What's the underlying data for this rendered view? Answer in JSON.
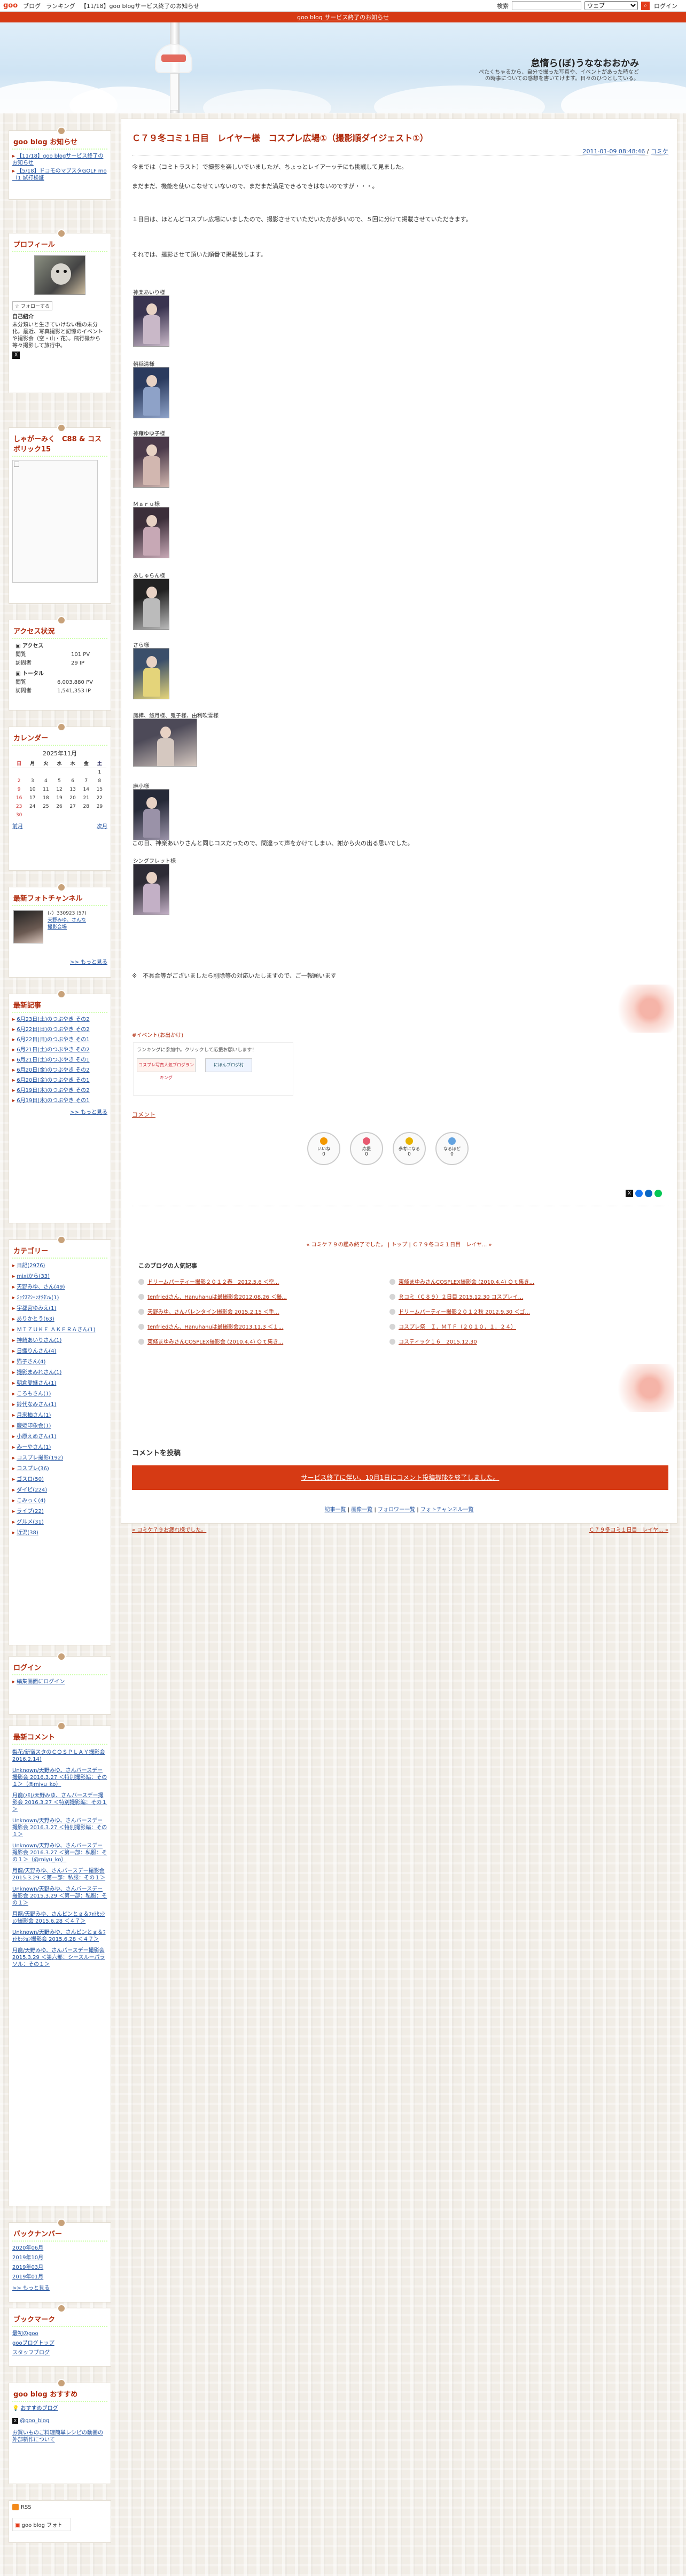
{
  "topbar": {
    "logo": "goo",
    "links": [
      "ブログ",
      "ランキング",
      "【11/18】goo blogサービス終了のお知らせ"
    ],
    "search_label": "検索",
    "search_select": "ウェブ",
    "login": "ログイン"
  },
  "notice": "goo blog サービス終了のお知らせ",
  "blog": {
    "title": "怠惰ら(ぼ)うななおおかみ",
    "description": "ぺたくちゃるから、自分で撮った写真や、イベントがあった時などの時事についての感想を書いてけます。日々のひつとしている。"
  },
  "sidebar": {
    "news": {
      "title": "goo blog お知らせ",
      "items": [
        "【11/18】goo blogサービス終了のお知らせ",
        "【5/18】ドコモのマブスタGOLF mo（1 試打検証"
      ]
    },
    "profile": {
      "title": "プロフィール",
      "follow": "フォローする",
      "intro_label": "自己紹介",
      "intro": "未分類いと生きていけない程の未分化。最近、写真撮影と記憶のイベントや撮影会（空・山・花）。飛行機から等々撮影して旅行中。"
    },
    "ad": {
      "title": "しゃがーみく　C88 & コスボリック15"
    },
    "access": {
      "title": "アクセス状況",
      "access_label": "アクセス",
      "today_view": "閲覧",
      "today_view_val": "101 PV",
      "today_visit": "訪問者",
      "today_visit_val": "29 IP",
      "total_label": "トータル",
      "total_view": "閲覧",
      "total_view_val": "6,003,880 PV",
      "total_visit": "訪問者",
      "total_visit_val": "1,541,353 IP"
    },
    "calendar": {
      "title": "カレンダー",
      "month": "2025年11月",
      "days": [
        "日",
        "月",
        "火",
        "水",
        "木",
        "金",
        "土"
      ],
      "weeks": [
        [
          "",
          "",
          "",
          "",
          "",
          "",
          "1"
        ],
        [
          "2",
          "3",
          "4",
          "5",
          "6",
          "7",
          "8"
        ],
        [
          "9",
          "10",
          "11",
          "12",
          "13",
          "14",
          "15"
        ],
        [
          "16",
          "17",
          "18",
          "19",
          "20",
          "21",
          "22"
        ],
        [
          "23",
          "24",
          "25",
          "26",
          "27",
          "28",
          "29"
        ],
        [
          "30",
          "",
          "",
          "",
          "",
          "",
          ""
        ]
      ],
      "prev": "前月",
      "next": "次月"
    },
    "photo": {
      "title": "最新フォトチャンネル",
      "count": "(ﾉ）330923 (57)",
      "name": "天野みゆ、さんな",
      "sub": "撮影会場",
      "more": ">> もっと見る"
    },
    "recent": {
      "title": "最新記事",
      "items": [
        "6月23日(土)のつぶやき その2",
        "6月22日(日)のつぶやき その2",
        "6月22日(日)のつぶやき その1",
        "6月21日(土)のつぶやき その2",
        "6月21日(土)のつぶやき その1",
        "6月20日(金)のつぶやき その2",
        "6月20日(金)のつぶやき その1",
        "6月19日(木)のつぶやき その2",
        "6月19日(木)のつぶやき その1"
      ],
      "more": ">> もっと見る"
    },
    "category": {
      "title": "カテゴリー",
      "items": [
        "日記(2976)",
        "mixiから(33)",
        "天野みゆ、さん(49)",
        "ﾐｯｸｽﾏｼｰﾝｵｸﾀﾝﾑ(1)",
        "宇都宮ゆみえ(1)",
        "ありかとう(63)",
        "ＭＩＺＵＫＥ ＡＫＥＲＡさん(1)",
        "神崎あいりさん(1)",
        "日織りんさん(4)",
        "猫子さん(4)",
        "撮影まみれさん(1)",
        "朝倉愛継さん(1)",
        "ころもさん(1)",
        "鈴代なみさん(1)",
        "月来柚さん(1)",
        "慶姫印象会(1)",
        "小原えめさん(1)",
        "みーやさん(1)",
        "コスプレ撮影(192)",
        "コスプレ(36)",
        "ゴスロ(50)",
        "ダイビ(224)",
        "こみっく(4)",
        "ライブ(22)",
        "グルメ(31)",
        "近況(38)"
      ]
    },
    "login": {
      "title": "ログイン",
      "link": "編集画面にログイン"
    },
    "comments": {
      "title": "最新コメント",
      "items": [
        "梨花/新宿スタのＣＯＳＰＬＡＹ撮影会 2016.2.14)",
        "Unknown/天野みゆ、さんバースデー撮影会 2016.3.27 ＜特別撮影編：その１＞（@miyu_ko）",
        "月龍(ﾒﾓ)/天野みゆ、さんバースデー撮影会 2016.3.27 ＜特別撮影編：その１＞",
        "Unknown/天野みゆ、さんバースデー撮影会 2016.3.27 ＜特別撮影編：その１＞",
        "Unknown/天野みゆ、さんバースデー撮影会 2016.3.27 ＜第一部：私服：その１＞（@miyu_ko）",
        "月龍/天野みゆ、さんバースデー撮影会 2015.3.29 ＜第一部：私服：その１＞",
        "Unknown/天野みゆ、さんバースデー撮影会 2015.3.29 ＜第一部：私服：その１＞",
        "月龍/天野みゆ、さんピンとｇ＆ﾌｫﾄｾｯｼｮﾝ撮影会 2015.6.28 ＜４７＞",
        "Unknown/天野みゆ、さんピンとｇ＆ﾌｫﾄｾｯｼｮﾝ撮影会 2015.6.28 ＜４７＞",
        "月龍/天野みゆ、さんバースデー撮影会 2015.3.29 ＜第六部：シースルーパラソル：その１＞"
      ]
    },
    "backnumber": {
      "title": "バックナンバー",
      "items": [
        "2020年06月",
        "2019年10月",
        "2019年03月",
        "2019年01月"
      ],
      "more": ">> もっと見る"
    },
    "bookmark": {
      "title": "ブックマーク",
      "items": [
        "最初のgoo",
        "gooブログトップ",
        "スタッフブログ"
      ]
    },
    "recommend": {
      "title": "goo blog おすすめ",
      "items": [
        "おすすめブログ",
        "@goo_blog",
        "お買いものご料理簡単レシピの動画の外部新作について"
      ]
    },
    "footer": {
      "rss": "RSS",
      "logo": "goo blog フォト"
    }
  },
  "article": {
    "title": "Ｃ７９冬コミ１日目　レイヤー様　コスプレ広場①（撮影順ダイジェスト①）",
    "date": "2011-01-09 08:48:46",
    "category": "コミケ",
    "paragraphs": [
      "今までは（コミトラスト）で撮影を楽しいでいましたが、ちょっとレイアーッチにも挑戦して見ました。",
      "まだまだ、機能を使いこなせていないので、まだまだ満足できるできはないのですが・・・。",
      "１日目は、ほとんどコスプレ広場にいましたので、撮影させていただいた方が多いので、５回に分けて掲載させていただきます。",
      "それでは、撮影させて頂いた順番で掲載致します。"
    ],
    "captions": [
      "神楽あいり様",
      "朝稲清様",
      "神薙ゆゆ子様",
      "Ｍａｒｕ様",
      "あしゅらん様",
      "さら様",
      "鳳樺、悠月様、兎子様、由利吹雪様",
      "麻小様",
      "シングフレット様"
    ],
    "outro": "この日、神楽あいりさんと同じコスだったので、間違って声をかけてしまい、謝から火の出る思いでした。",
    "disclaimer": "※　不具合等がございましたら削除等の対応いたしますので、ご一報願います",
    "tag": "#イベント(お出かけ)",
    "rank_text": "ランキングに参加中。クリックして応援お願いします！",
    "rank_btns": [
      "コスプレ写真人気ブログランキング",
      "にほんブログ村"
    ],
    "comment_link": "コメント",
    "reactions": [
      {
        "label": "いいね",
        "count": "0"
      },
      {
        "label": "応援",
        "count": "0"
      },
      {
        "label": "参考になる",
        "count": "0"
      },
      {
        "label": "なるほど",
        "count": "0"
      }
    ],
    "nav": "« コミケ７９の鑑み終了でした。 | トップ | Ｃ７９冬コミ１日目　レイヤ... »",
    "popular_title": "このブログの人気記事",
    "popular": [
      "ドリームパーティー撮影２０１２春　2012.5.6 ＜空...",
      "tenfriedさん、Hanuhanuは最撮影会2012.08.26 ＜撮...",
      "天野みゆ、さんバレンタイン撮影会 2015.2.15 ＜手...",
      "tenfriedさん、Hanuhanuは最撮影会2013.11.3 ＜１...",
      "東條まゆみさんCOSPLEX撮影会 (2010.4.4) Ｏｔ集き...",
      "東條まゆみさんCOSPLEX撮影会 (2010.4.4) Ｏｔ集き...",
      "Ｒコミ（Ｃ８９）２日目 2015.12.30 コスプレイ...",
      "ドリームパーティー撮影２０１２秋 2012.9.30 ＜ゴ...",
      "コスプレ祭　Ｉ．ＭＴＦ（２０１０．１．２４）",
      "コスティック１６　2015.12.30"
    ],
    "comment_heading": "コメントを投稿",
    "comment_notice": "サービス終了に伴い、10月1日にコメント投稿機能を終了しました。",
    "bottom_links": [
      "記事一覧",
      "画像一覧",
      "フォロワー一覧",
      "フォトチャンネル一覧"
    ],
    "prev": "« コミケ７９お疲れ様でした。",
    "next": "Ｃ７９冬コミ１日目　レイヤ... »"
  }
}
